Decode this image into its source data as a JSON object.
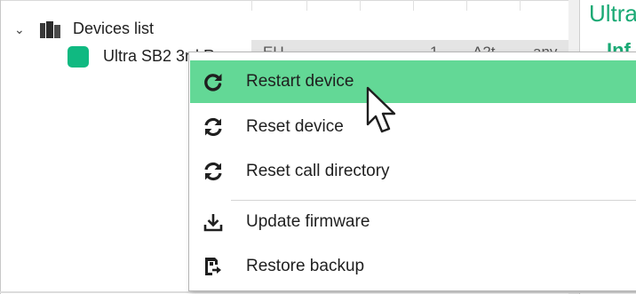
{
  "tree": {
    "root_label": "Devices list",
    "device": {
      "name": "Ultra SB2 3rd Ra",
      "cols": [
        "EU",
        "1",
        "A2t",
        "any"
      ],
      "status_color": "#10b981"
    }
  },
  "side_panel": {
    "title": "Ultra",
    "subtitle": "Inf"
  },
  "context_menu": {
    "items": [
      {
        "label": "Restart device",
        "icon": "restart-icon"
      },
      {
        "label": "Reset device",
        "icon": "reset-icon"
      },
      {
        "label": "Reset call directory",
        "icon": "reset-call-directory-icon"
      },
      {
        "label": "Update firmware",
        "icon": "download-icon"
      },
      {
        "label": "Restore backup",
        "icon": "restore-backup-icon"
      }
    ],
    "highlight_color": "#63d896"
  }
}
